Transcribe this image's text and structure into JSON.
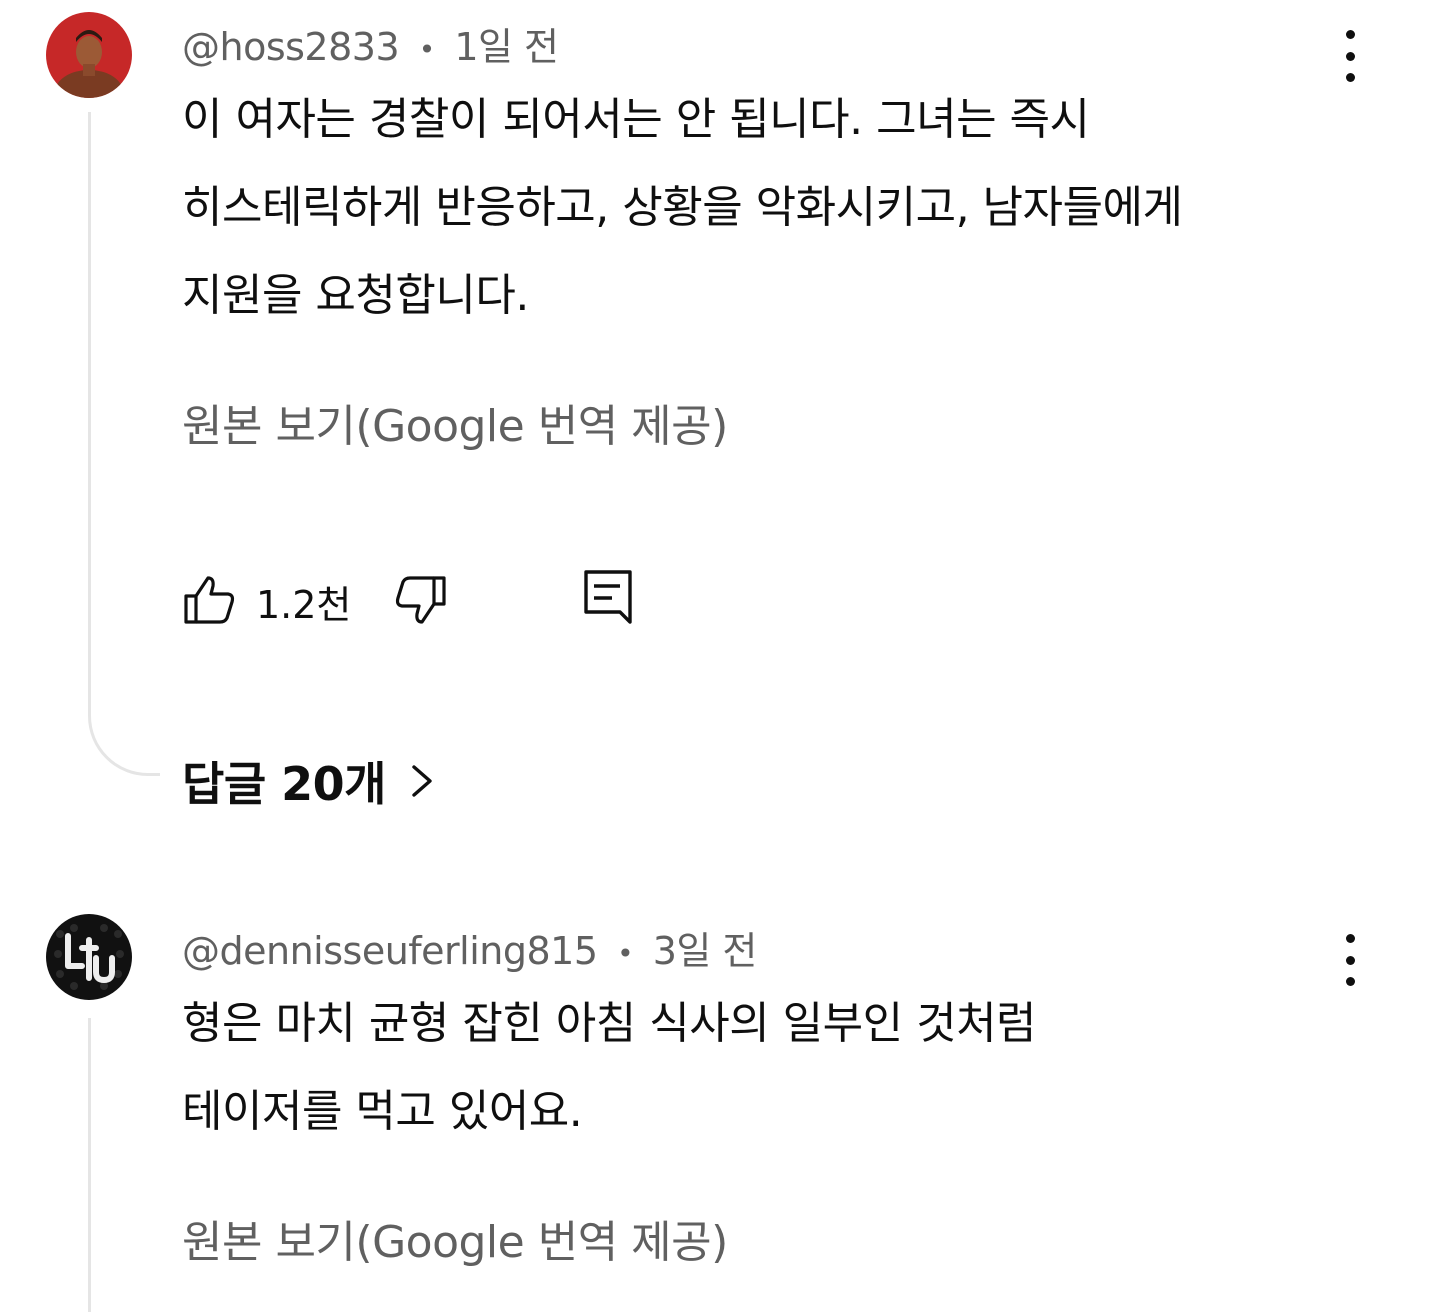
{
  "comments": [
    {
      "author": "@hoss2833",
      "separator": "•",
      "time": "1일 전",
      "lines": [
        "이 여자는 경찰이 되어서는 안 됩니다. 그녀는 즉시",
        "히스테릭하게 반응하고, 상황을 악화시키고, 남자들에게",
        "지원을 요청합니다."
      ],
      "translate_link": "원본 보기(Google 번역 제공)",
      "like_count": "1.2천",
      "replies_label": "답글 20개",
      "avatar_color": "#c62828"
    },
    {
      "author": "@dennisseuferling815",
      "separator": "•",
      "time": "3일 전",
      "lines": [
        "형은 마치 균형 잡힌 아침 식사의 일부인 것처럼",
        "테이저를 먹고 있어요."
      ],
      "translate_link": "원본 보기(Google 번역 제공)",
      "avatar_color": "#111111"
    }
  ],
  "icons": {
    "more": "kebab-vertical-icon",
    "like": "thumbs-up-icon",
    "dislike": "thumbs-down-icon",
    "reply": "reply-comment-icon",
    "chevron": "chevron-right-icon"
  }
}
